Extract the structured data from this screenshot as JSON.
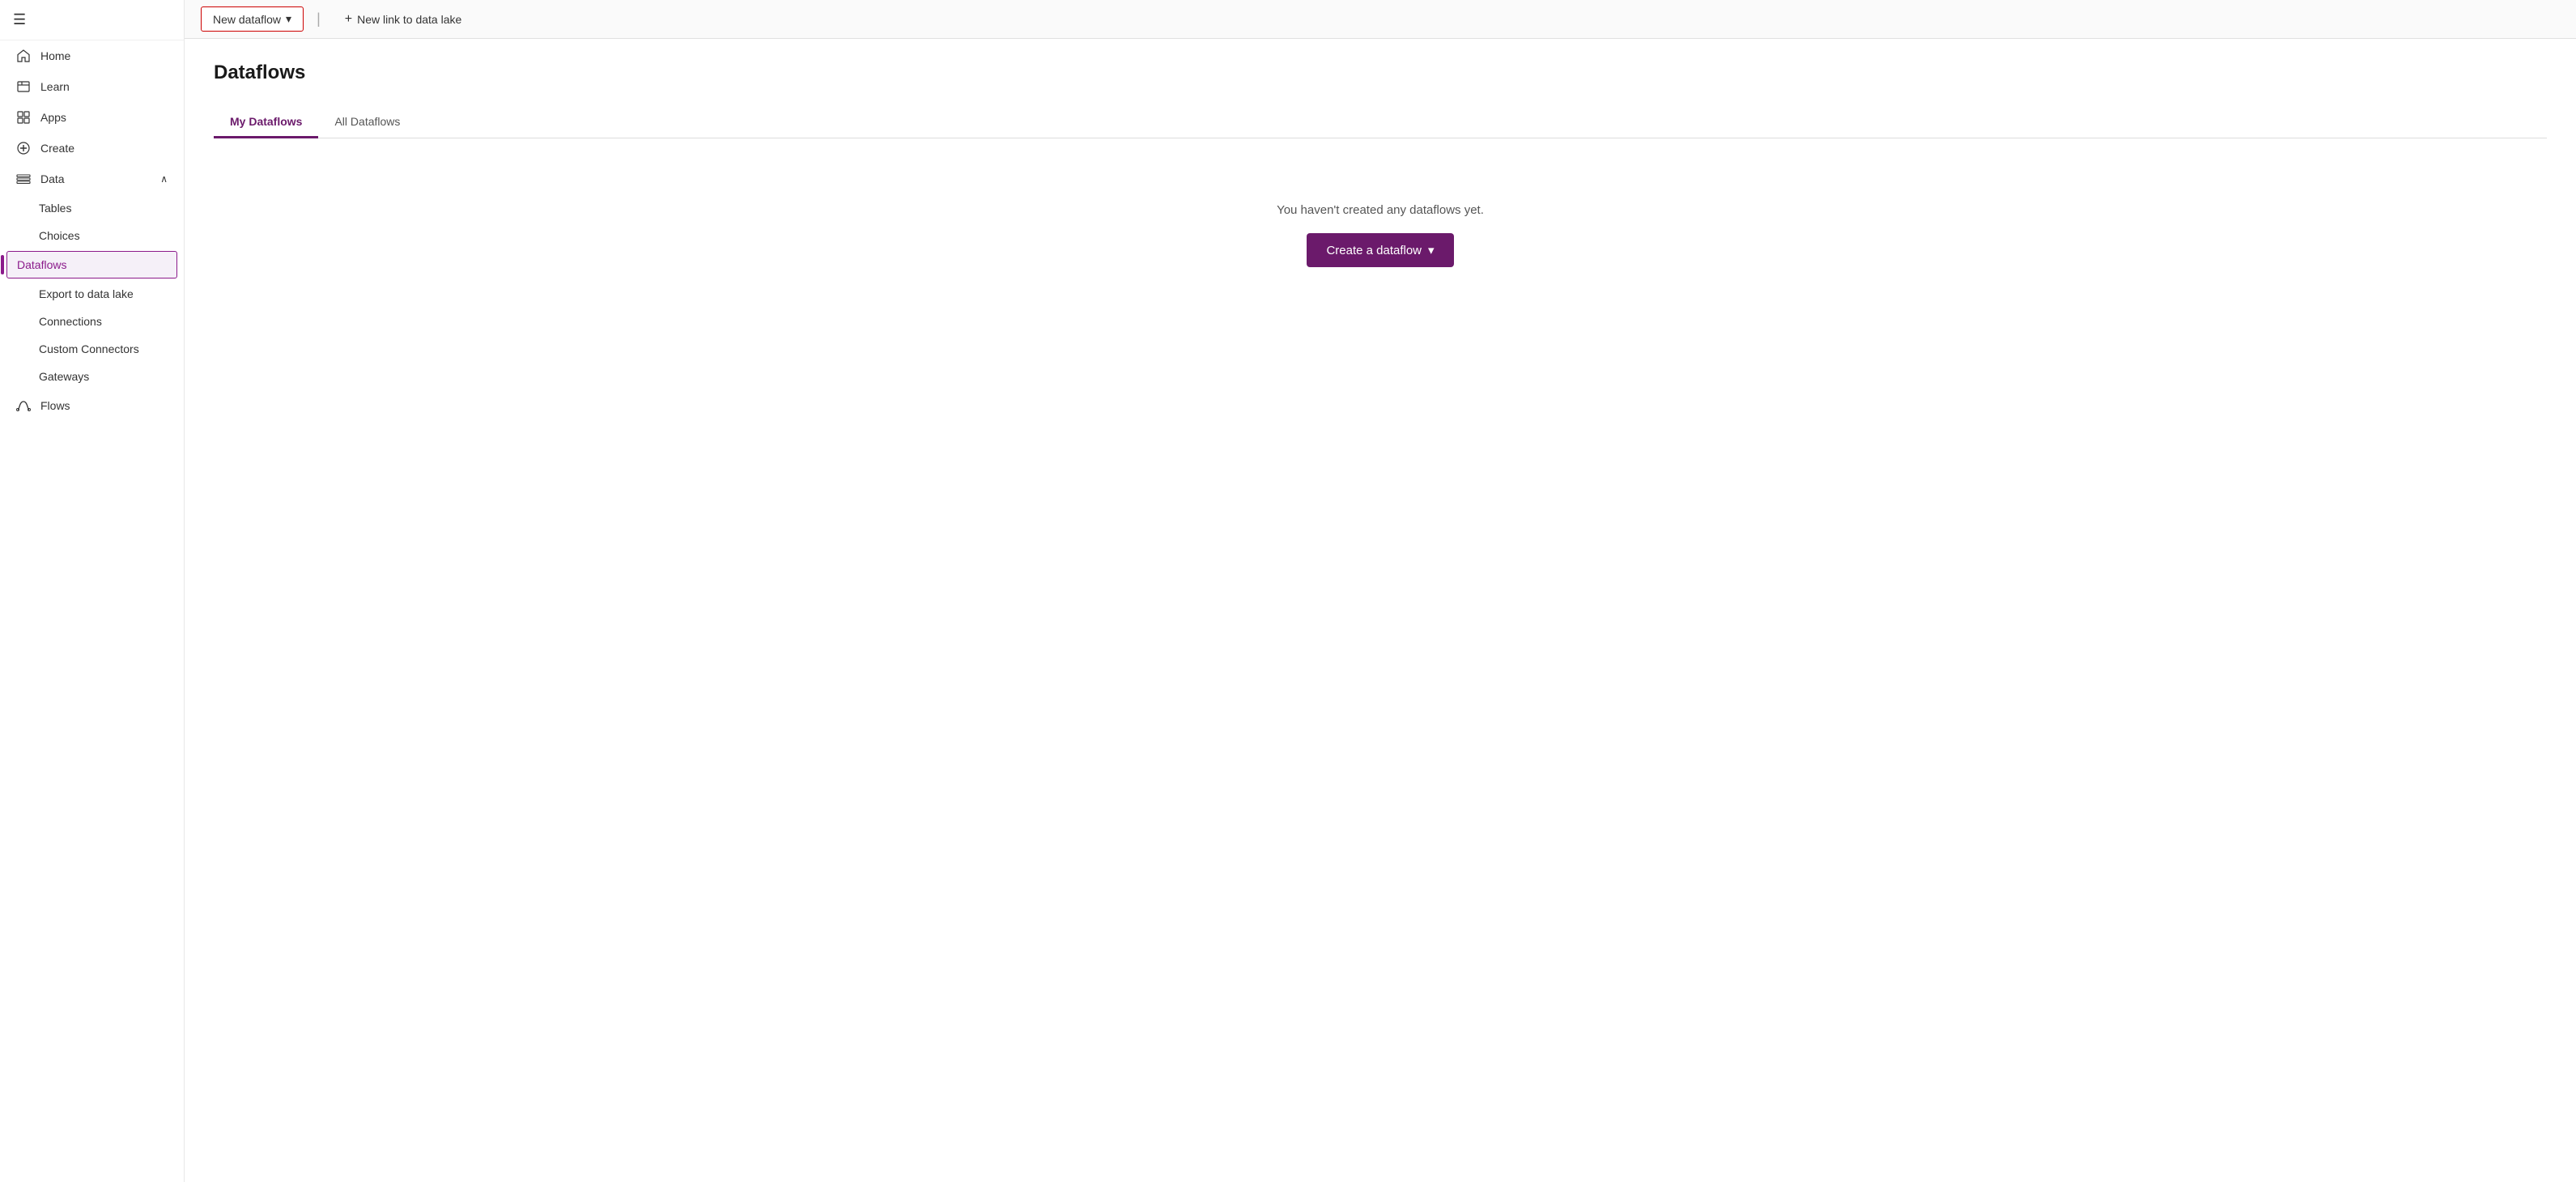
{
  "sidebar": {
    "hamburger": "☰",
    "items": [
      {
        "id": "home",
        "label": "Home",
        "icon": "home-icon"
      },
      {
        "id": "learn",
        "label": "Learn",
        "icon": "learn-icon"
      },
      {
        "id": "apps",
        "label": "Apps",
        "icon": "apps-icon"
      },
      {
        "id": "create",
        "label": "Create",
        "icon": "create-icon"
      },
      {
        "id": "data",
        "label": "Data",
        "icon": "data-icon",
        "hasChevron": true,
        "expanded": true
      }
    ],
    "data_sub_items": [
      {
        "id": "tables",
        "label": "Tables"
      },
      {
        "id": "choices",
        "label": "Choices"
      },
      {
        "id": "dataflows",
        "label": "Dataflows",
        "active": true
      },
      {
        "id": "export-to-data-lake",
        "label": "Export to data lake"
      },
      {
        "id": "connections",
        "label": "Connections"
      },
      {
        "id": "custom-connectors",
        "label": "Custom Connectors"
      },
      {
        "id": "gateways",
        "label": "Gateways"
      }
    ],
    "bottom_items": [
      {
        "id": "flows",
        "label": "Flows",
        "icon": "flows-icon"
      }
    ]
  },
  "toolbar": {
    "new_dataflow_label": "New dataflow",
    "new_link_label": "New link to data lake"
  },
  "content": {
    "page_title": "Dataflows",
    "tabs": [
      {
        "id": "my-dataflows",
        "label": "My Dataflows",
        "active": true
      },
      {
        "id": "all-dataflows",
        "label": "All Dataflows",
        "active": false
      }
    ],
    "empty_state_text": "You haven't created any dataflows yet.",
    "create_button_label": "Create a dataflow"
  },
  "colors": {
    "accent": "#6b1a6b",
    "border_highlight": "#cc0000"
  }
}
